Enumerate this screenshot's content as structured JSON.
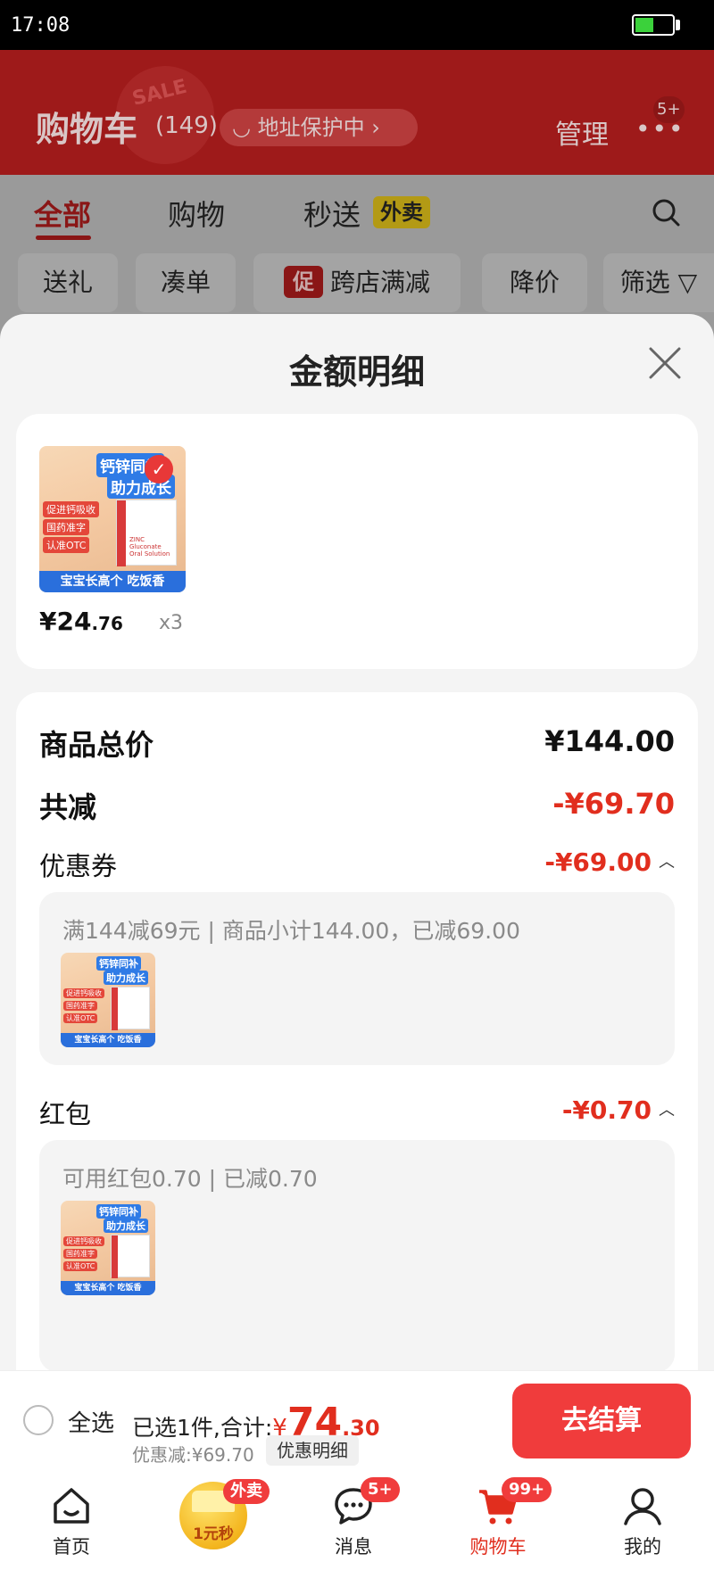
{
  "status_bar": {
    "time": "17:08",
    "battery_level": 0.5
  },
  "cart": {
    "sale_stamp": "SALE",
    "title": "购物车",
    "count": "(149)",
    "address_protection": "地址保护中",
    "manage": "管理",
    "more_badge": "5+"
  },
  "tabs": [
    {
      "label": "全部",
      "active": true
    },
    {
      "label": "购物",
      "active": false
    },
    {
      "label": "秒送",
      "active": false,
      "tag": "外卖"
    }
  ],
  "filters": {
    "gift": "送礼",
    "bundle": "凑单",
    "promo_tag": "促",
    "cross_store": "跨店满减",
    "price_drop": "降价",
    "filter": "筛选"
  },
  "modal": {
    "title": "金额明细",
    "product": {
      "thumb": {
        "ribbon_1": "钙锌同补",
        "ribbon_2": "助力成长",
        "tags": [
          "促进钙吸收",
          "国药准字",
          "认准OTC"
        ],
        "banner": "宝宝长高个 吃饭香",
        "box_text": "ZINC Gluconate Oral Solution"
      },
      "price_int": "¥24",
      "price_dec": ".76",
      "quantity": "x3"
    },
    "summary": {
      "total_label": "商品总价",
      "total_value": "¥144.00",
      "discount_label": "共减",
      "discount_value": "-¥69.70",
      "coupon_label": "优惠券",
      "coupon_value": "-¥69.00",
      "coupon_detail": "满144减69元 | 商品小计144.00，已减69.00",
      "redpacket_label": "红包",
      "redpacket_value": "-¥0.70",
      "redpacket_detail": "可用红包0.70 | 已减0.70"
    }
  },
  "checkout": {
    "select_all": "全选",
    "selected_text": "已选1件,合计:",
    "total_symbol": "¥",
    "total_int": "74",
    "total_dec": ".30",
    "discount_line": "优惠减:¥69.70",
    "discount_detail_button": "优惠明细",
    "checkout_button": "去结算"
  },
  "bottom_nav": [
    {
      "label": "首页",
      "icon": "home-icon"
    },
    {
      "label": "",
      "icon": "flash-sale-icon",
      "badge": "外卖",
      "coin_text": "1元秒"
    },
    {
      "label": "消息",
      "icon": "message-icon",
      "badge": "5+"
    },
    {
      "label": "购物车",
      "icon": "cart-icon",
      "badge": "99+",
      "active": true
    },
    {
      "label": "我的",
      "icon": "profile-icon"
    }
  ],
  "colors": {
    "accent": "#e12e1e",
    "checkout_button": "#f03c3c",
    "header_dim": "#9e1a1a"
  }
}
